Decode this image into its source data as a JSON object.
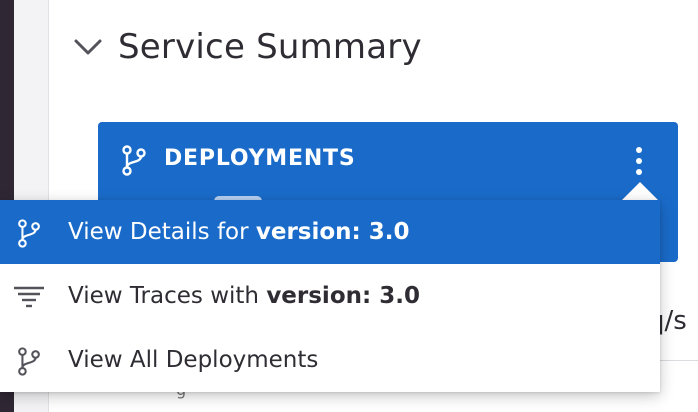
{
  "section": {
    "title": "Service Summary",
    "chevron_icon": "chevron-down-icon"
  },
  "card": {
    "title": "DEPLOYMENTS",
    "icon": "git-branch-icon",
    "more_icon": "kebab-menu-icon",
    "color": "#1a6bc9"
  },
  "background": {
    "partial_text": "q/s",
    "bottom_glyph": "g"
  },
  "menu": {
    "items": [
      {
        "icon": "git-branch-icon",
        "prefix": "View Details for ",
        "bold": "version: 3.0",
        "active": true
      },
      {
        "icon": "traces-filter-icon",
        "prefix": "View Traces with ",
        "bold": "version: 3.0",
        "active": false
      },
      {
        "icon": "git-branch-icon",
        "prefix": "View All Deployments",
        "bold": "",
        "active": false
      }
    ],
    "active_color": "#1a6bc9"
  }
}
